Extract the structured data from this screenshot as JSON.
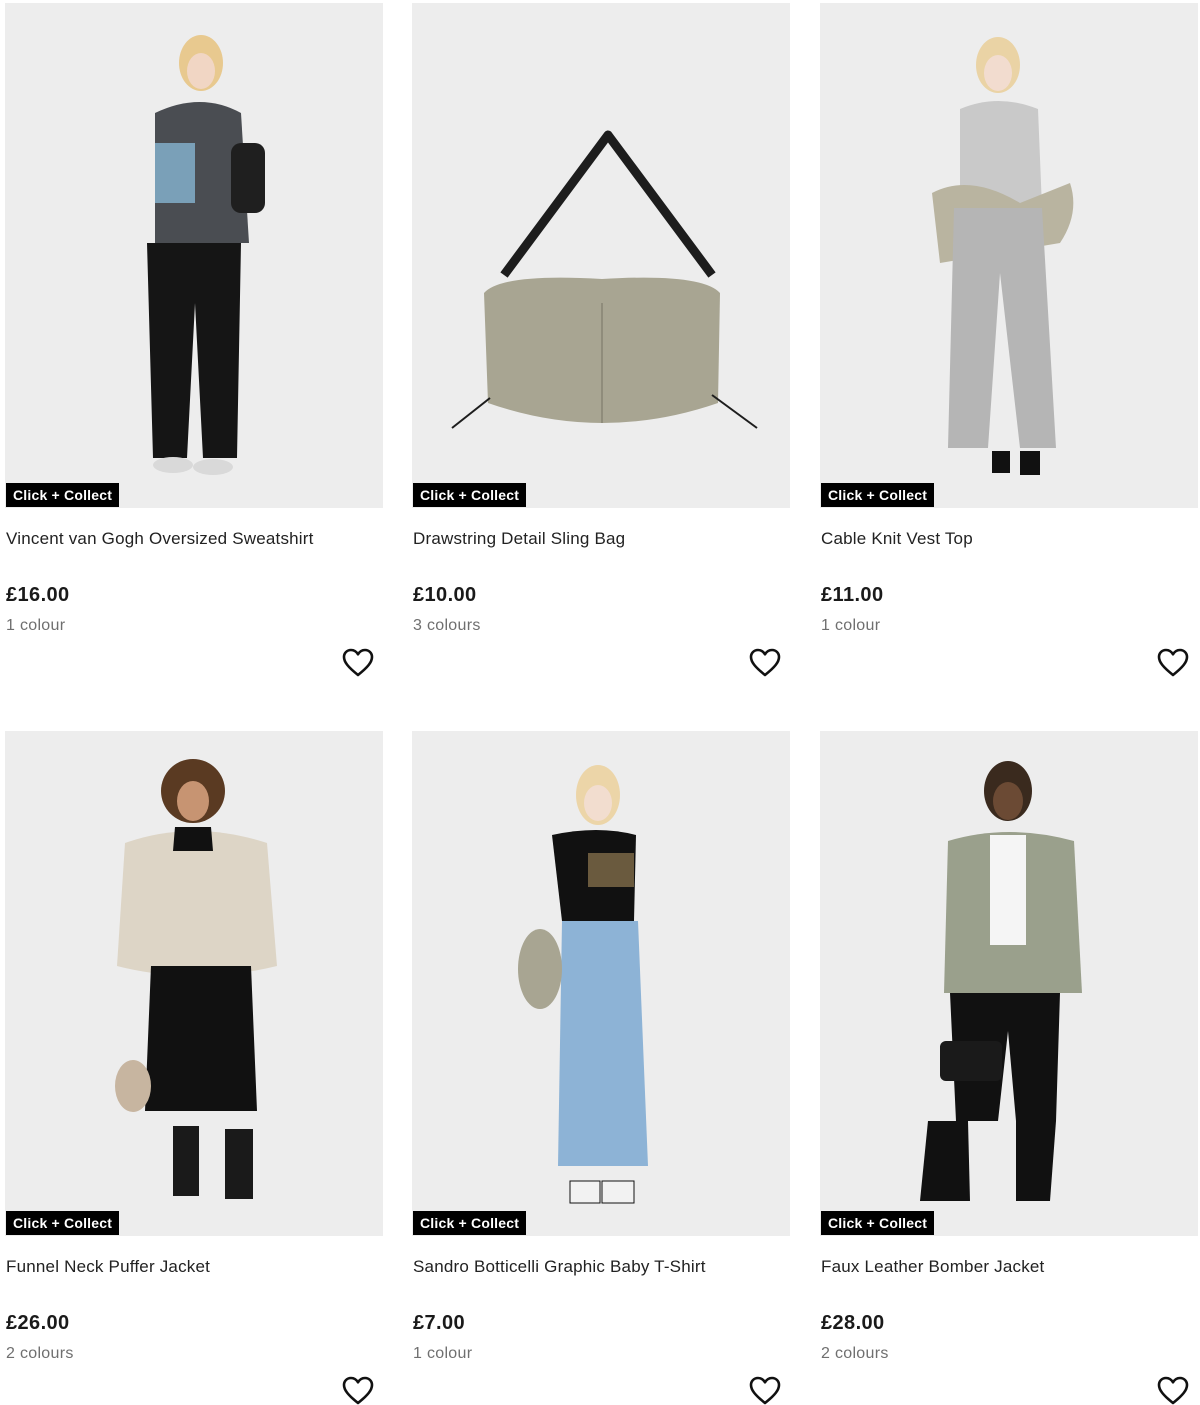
{
  "products": [
    {
      "name": "Vincent van Gogh Oversized Sweatshirt",
      "price": "£16.00",
      "colours": "1 colour",
      "badge": "Click + Collect",
      "image": "model-sweatshirt"
    },
    {
      "name": "Drawstring Detail Sling Bag",
      "price": "£10.00",
      "colours": "3 colours",
      "badge": "Click + Collect",
      "image": "sling-bag"
    },
    {
      "name": "Cable Knit Vest Top",
      "price": "£11.00",
      "colours": "1 colour",
      "badge": "Click + Collect",
      "image": "model-vest-top"
    },
    {
      "name": "Funnel Neck Puffer Jacket",
      "price": "£26.00",
      "colours": "2 colours",
      "badge": "Click + Collect",
      "image": "model-puffer-jacket"
    },
    {
      "name": "Sandro Botticelli Graphic Baby T-Shirt",
      "price": "£7.00",
      "colours": "1 colour",
      "badge": "Click + Collect",
      "image": "model-baby-tshirt"
    },
    {
      "name": "Faux Leather Bomber Jacket",
      "price": "£28.00",
      "colours": "2 colours",
      "badge": "Click + Collect",
      "image": "model-bomber-jacket"
    }
  ],
  "icons": {
    "favourite": "heart-outline-icon"
  },
  "colors": {
    "image_bg": "#ededed",
    "badge_bg": "#000000",
    "badge_text": "#ffffff",
    "muted_text": "#6f6f6f"
  }
}
